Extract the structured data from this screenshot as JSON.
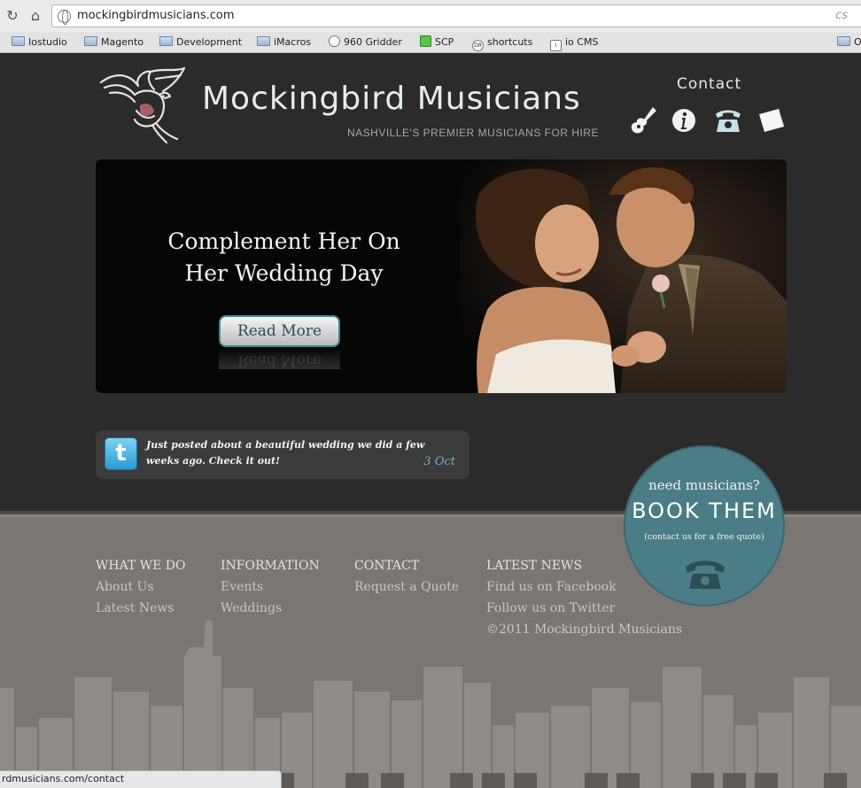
{
  "browser": {
    "url": "mockingbirdmusicians.com",
    "omnibox_extension": "cs",
    "bookmarks": [
      {
        "label": "Iostudio",
        "icon": "folder-icon"
      },
      {
        "label": "Magento",
        "icon": "folder-icon"
      },
      {
        "label": "Development",
        "icon": "folder-icon"
      },
      {
        "label": "iMacros",
        "icon": "folder-icon"
      },
      {
        "label": "960 Gridder",
        "icon": "gridder-icon"
      },
      {
        "label": "SCP",
        "icon": "scp-icon"
      },
      {
        "label": "shortcuts",
        "icon": "dr-icon"
      },
      {
        "label": "io CMS",
        "icon": "io-icon"
      },
      {
        "label": "O",
        "icon": "folder-icon"
      }
    ],
    "status_url": "rdmusicians.com/contact"
  },
  "header": {
    "logo_text": "Mockingbird Musicians",
    "tagline": "NASHVILLE'S  PREMIER  MUSICIANS FOR HIRE",
    "contact_label": "Contact",
    "contact_icons": [
      "guitar-icon",
      "info-icon",
      "telephone-icon",
      "paper-icon"
    ]
  },
  "hero": {
    "title": "Complement Her On Her Wedding Day",
    "button_label": "Read More"
  },
  "tweet": {
    "text": "Just posted about a beautiful wedding we did a few weeks ago. Check it out!",
    "date": "3 Oct"
  },
  "book": {
    "line1": "need musicians?",
    "line2": "BOOK  THEM",
    "line3": "(contact us for a free quote)"
  },
  "footer": {
    "columns": [
      {
        "heading": "WHAT WE DO",
        "links": [
          "About Us",
          "Latest News"
        ]
      },
      {
        "heading": "INFORMATION",
        "links": [
          "Events",
          "Weddings"
        ]
      },
      {
        "heading": "CONTACT",
        "links": [
          "Request a Quote"
        ]
      },
      {
        "heading": "LATEST NEWS",
        "links": [
          "Find us on Facebook",
          "Follow us on Twitter",
          "©2011 Mockingbird Musicians"
        ]
      }
    ]
  },
  "colors": {
    "page_bg": "#2b2b2b",
    "footer_bg": "#7a7672",
    "badge_teal": "#4b7d86",
    "accent_link": "#6fb3c9"
  }
}
